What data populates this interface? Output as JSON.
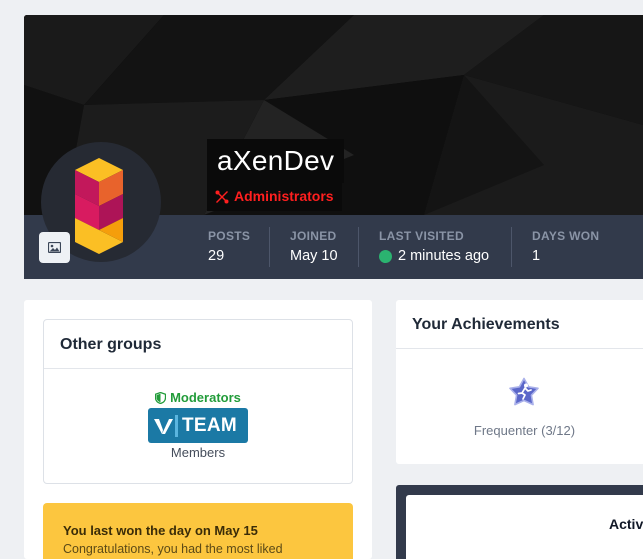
{
  "profile": {
    "username": "aXenDev",
    "group": "Administrators",
    "group_icon": "wrench-screwdriver-icon",
    "group_color": "#ff1f1f",
    "cover_button_icon": "image-icon"
  },
  "stats": [
    {
      "label": "POSTS",
      "value": "29"
    },
    {
      "label": "JOINED",
      "value": "May 10"
    },
    {
      "label": "LAST VISITED",
      "value": "2 minutes ago",
      "status_icon": "online-dot",
      "status_color": "#2bb370"
    },
    {
      "label": "DAYS WON",
      "value": "1"
    }
  ],
  "other_groups": {
    "title": "Other groups",
    "group_name": "Moderators",
    "group_color": "#229c3a",
    "group_icon": "shield-icon",
    "badge_text": "TEAM",
    "badge_color": "#1b79a5",
    "members_label": "Members"
  },
  "day_won": {
    "title": "You last won the day on May 15",
    "text": "Congratulations, you had the most liked"
  },
  "achievements": {
    "title": "Your Achievements",
    "item_label": "Frequenter (3/12)",
    "item_icon": "running-star-icon"
  },
  "activity": {
    "tab_label": "Activ"
  }
}
